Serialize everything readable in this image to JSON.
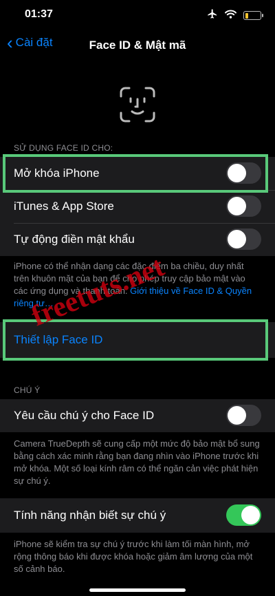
{
  "status_bar": {
    "time": "01:37",
    "battery_level": 0.2
  },
  "nav": {
    "back_label": "Cài đặt",
    "title": "Face ID & Mật mã"
  },
  "use_for": {
    "header": "SỬ DỤNG FACE ID CHO:",
    "items": [
      {
        "label": "Mở khóa iPhone",
        "on": false
      },
      {
        "label": "iTunes & App Store",
        "on": false
      },
      {
        "label": "Tự động điền mật khẩu",
        "on": false
      }
    ],
    "footnote": "iPhone có thể nhận dạng các đặc điểm ba chiều, duy nhất trên khuôn mặt của bạn để cho phép truy cập bảo mật vào các ứng dụng và thanh toán. ",
    "footnote_link": "Giới thiệu về Face ID & Quyền riêng tư…"
  },
  "setup": {
    "label": "Thiết lập Face ID"
  },
  "attention": {
    "header": "CHÚ Ý",
    "require_label": "Yêu cầu chú ý cho Face ID",
    "require_on": false,
    "require_footnote": "Camera TrueDepth sẽ cung cấp một mức độ bảo mật bổ sung bằng cách xác minh rằng bạn đang nhìn vào iPhone trước khi mở khóa. Một số loại kính râm có thể ngăn cản việc phát hiện sự chú ý.",
    "aware_label": "Tính năng nhận biết sự chú ý",
    "aware_on": true,
    "aware_footnote": "iPhone sẽ kiểm tra sự chú ý trước khi làm tối màn hình, mở rộng thông báo khi được khóa hoặc giảm âm lượng của một số cảnh báo."
  },
  "watermark": "freetuts.net",
  "colors": {
    "accent": "#0a84ff",
    "toggle_on": "#34c759",
    "highlight": "#59c97a",
    "watermark": "#d2000f"
  }
}
